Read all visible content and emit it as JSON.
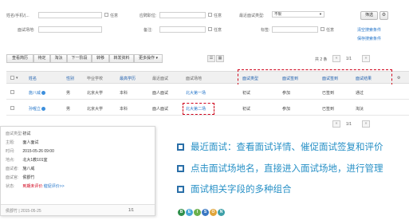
{
  "filters": {
    "name_phone_label": "姓名/手机/(...",
    "checkbox_label": "任意",
    "position_label": "应聘职位:",
    "interview_type_label": "最近面试类型:",
    "interview_type_value": "不限",
    "venue_label": "面试场地:",
    "remark_label": "备注:",
    "tag_label": "标签:",
    "filter_button": "筛选",
    "clear_link": "清空搜索条件",
    "save_link": "保存搜索条件"
  },
  "toolbar": {
    "buttons": [
      "查看简历",
      "待定",
      "淘汰",
      "下一阶段",
      "转移",
      "转发资料",
      "更多操作"
    ],
    "more_caret": "▾",
    "total": "共 2 条",
    "page": "1/1",
    "prev": "«",
    "next": "»"
  },
  "table": {
    "headers": {
      "name": "姓名",
      "gender": "性别",
      "school": "毕业学校",
      "degree": "最高学历",
      "recent": "最近面试",
      "venue": "面试场地",
      "type": "面试类型",
      "signin": "面试签到",
      "review": "面试签到",
      "result": "面试结果"
    },
    "rows": [
      {
        "name": "施八威",
        "gender": "男",
        "school": "北京大学",
        "degree": "本科",
        "recent": "面人面试",
        "venue": "北大第一场",
        "type": "初试",
        "signin": "参加",
        "review": "已签到",
        "result": "通过"
      },
      {
        "name": "孙喔立",
        "gender": "男",
        "school": "北京大学",
        "degree": "本科",
        "recent": "面人面试",
        "venue": "北大第二场",
        "type": "初试",
        "signin": "参加",
        "review": "已签到",
        "result": "淘汰"
      }
    ]
  },
  "bottom_pager": {
    "page": "1/1"
  },
  "popup": {
    "type_label": "面试类型:",
    "type_value": "初试",
    "subject_label": "主题:",
    "subject_value": "面人面试",
    "time_label": "时间:",
    "time_value": "2015-05-26 09:00",
    "place_label": "地点:",
    "place_value": "北大1教101室",
    "interviewee_label": "面试者:",
    "interviewee_value": "施八威",
    "interviewer_label": "面试官:",
    "interviewer_value": "侯郡竹",
    "status_label": "状态:",
    "status_value": "到期未评价",
    "status_link": "催促评价>>",
    "footer_left": "侯郡竹 | 2015-05-25",
    "footer_right": "1/1"
  },
  "features": [
    "最近面试：查看面试详情、催促面试签复和评价",
    "点击面试场地名，直接进入面试场地，进行管理",
    "面试相关字段的多种组合"
  ],
  "dots": [
    {
      "letter": "B",
      "color": "#2f8f4b"
    },
    {
      "letter": "E",
      "color": "#47a6d9"
    },
    {
      "letter": "I",
      "color": "#6ab04c"
    },
    {
      "letter": "S",
      "color": "#3a78c2"
    },
    {
      "letter": "O",
      "color": "#e0a43a"
    },
    {
      "letter": "N",
      "color": "#3ea0a8"
    }
  ]
}
